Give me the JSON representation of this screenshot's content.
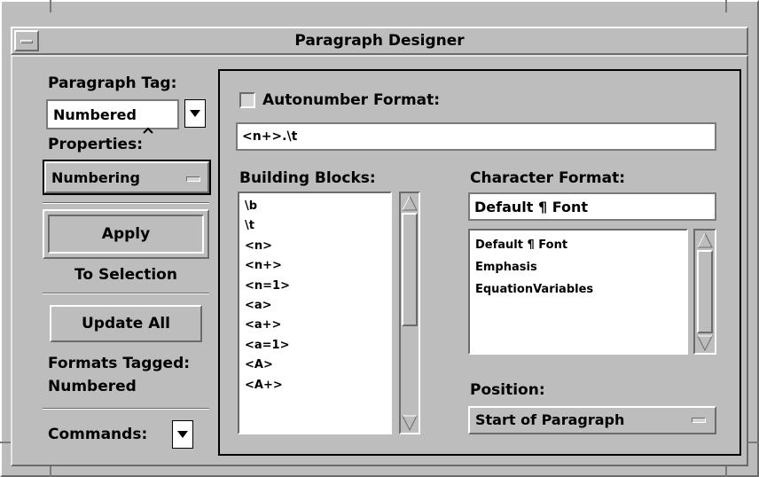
{
  "window": {
    "title": "Paragraph Designer"
  },
  "left": {
    "paragraph_tag_label": "Paragraph Tag:",
    "paragraph_tag_value": "Numbered",
    "properties_label": "Properties:",
    "properties_value": "Numbering",
    "apply_label": "Apply",
    "to_selection_label": "To Selection",
    "update_all_label": "Update All",
    "formats_tagged_label": "Formats Tagged:",
    "formats_tagged_value": "Numbered",
    "commands_label": "Commands:"
  },
  "numbering": {
    "autonumber_label": "Autonumber Format:",
    "autonumber_checked": false,
    "autonumber_value": "<n+>.\\t",
    "building_blocks_label": "Building Blocks:",
    "building_blocks": [
      "\\b",
      "\\t",
      "<n>",
      "<n+>",
      "<n=1>",
      "<a>",
      "<a+>",
      "<a=1>",
      "<A>",
      "<A+>"
    ],
    "character_format_label": "Character Format:",
    "character_format_value": "Default ¶ Font",
    "character_formats": [
      "Default ¶ Font",
      "Emphasis",
      "EquationVariables"
    ],
    "position_label": "Position:",
    "position_value": "Start of Paragraph"
  },
  "colors": {
    "window_bg": "#bdbdbd",
    "field_bg": "#ffffff",
    "title_bg": "#bdbdbd"
  }
}
